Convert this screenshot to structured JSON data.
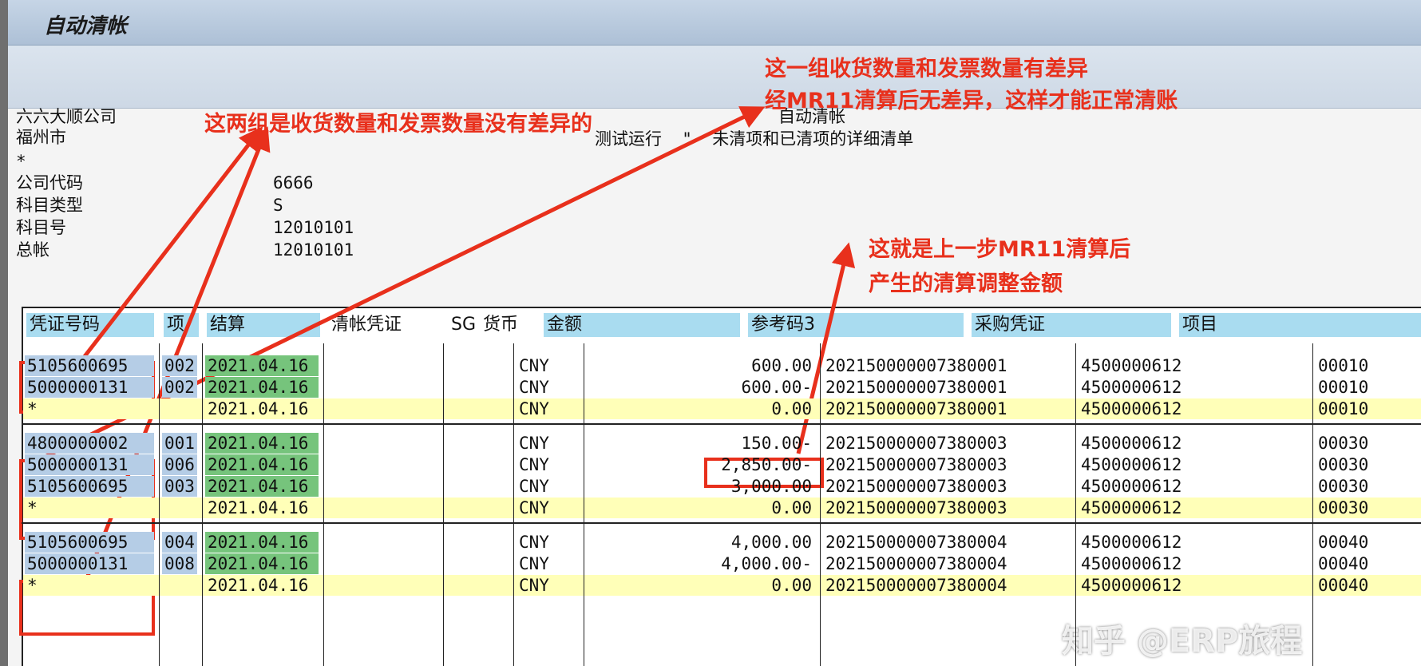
{
  "window": {
    "title": "自动清帐"
  },
  "report": {
    "company": "六六大顺公司",
    "city": "福州市",
    "star": "*",
    "heading": "自动清帐",
    "subheading": "测试运行  \"  未清项和已清项的详细清单",
    "fields": [
      {
        "label": "公司代码",
        "value": "6666"
      },
      {
        "label": "科目类型",
        "value": "S"
      },
      {
        "label": "科目号",
        "value": "12010101"
      },
      {
        "label": "总帐",
        "value": "12010101"
      }
    ]
  },
  "table": {
    "columns": [
      "凭证号码",
      "项",
      "结算",
      "清帐凭证",
      "SG",
      "货币",
      "金额",
      "参考码3",
      "采购凭证",
      "项目"
    ],
    "groups": [
      {
        "rows": [
          {
            "doc": "5105600695",
            "item": "002",
            "date": "2021.04.16",
            "cur": "CNY",
            "amount": "600.00",
            "ref": "202150000007380001",
            "po": "4500000612",
            "poitem": "00010",
            "sum": false
          },
          {
            "doc": "5000000131",
            "item": "002",
            "date": "2021.04.16",
            "cur": "CNY",
            "amount": "600.00-",
            "ref": "202150000007380001",
            "po": "4500000612",
            "poitem": "00010",
            "sum": false
          },
          {
            "doc": "*",
            "item": "",
            "date": "2021.04.16",
            "cur": "CNY",
            "amount": "0.00",
            "ref": "202150000007380001",
            "po": "4500000612",
            "poitem": "00010",
            "sum": true
          }
        ]
      },
      {
        "rows": [
          {
            "doc": "4800000002",
            "item": "001",
            "date": "2021.04.16",
            "cur": "CNY",
            "amount": "150.00-",
            "ref": "202150000007380003",
            "po": "4500000612",
            "poitem": "00030",
            "sum": false
          },
          {
            "doc": "5000000131",
            "item": "006",
            "date": "2021.04.16",
            "cur": "CNY",
            "amount": "2,850.00-",
            "ref": "202150000007380003",
            "po": "4500000612",
            "poitem": "00030",
            "sum": false
          },
          {
            "doc": "5105600695",
            "item": "003",
            "date": "2021.04.16",
            "cur": "CNY",
            "amount": "3,000.00",
            "ref": "202150000007380003",
            "po": "4500000612",
            "poitem": "00030",
            "sum": false
          },
          {
            "doc": "*",
            "item": "",
            "date": "2021.04.16",
            "cur": "CNY",
            "amount": "0.00",
            "ref": "202150000007380003",
            "po": "4500000612",
            "poitem": "00030",
            "sum": true
          }
        ]
      },
      {
        "rows": [
          {
            "doc": "5105600695",
            "item": "004",
            "date": "2021.04.16",
            "cur": "CNY",
            "amount": "4,000.00",
            "ref": "202150000007380004",
            "po": "4500000612",
            "poitem": "00040",
            "sum": false
          },
          {
            "doc": "5000000131",
            "item": "008",
            "date": "2021.04.16",
            "cur": "CNY",
            "amount": "4,000.00-",
            "ref": "202150000007380004",
            "po": "4500000612",
            "poitem": "00040",
            "sum": false
          },
          {
            "doc": "*",
            "item": "",
            "date": "2021.04.16",
            "cur": "CNY",
            "amount": "0.00",
            "ref": "202150000007380004",
            "po": "4500000612",
            "poitem": "00040",
            "sum": true
          }
        ]
      }
    ]
  },
  "annotations": {
    "note1": "这两组是收货数量和发票数量没有差异的",
    "note2_line1": "这一组收货数量和发票数量有差异",
    "note2_line2": "经MR11清算后无差异，这样才能正常清账",
    "note3_line1": "这就是上一步MR11清算后",
    "note3_line2": "产生的清算调整金额"
  },
  "watermark": "知乎 @ERP旅程",
  "colors": {
    "annotation": "#e8301c",
    "header_cell": "#a9dcf0",
    "doc_cell": "#b5cde6",
    "date_cell": "#76c47c",
    "sum_row": "#ffffb8"
  }
}
